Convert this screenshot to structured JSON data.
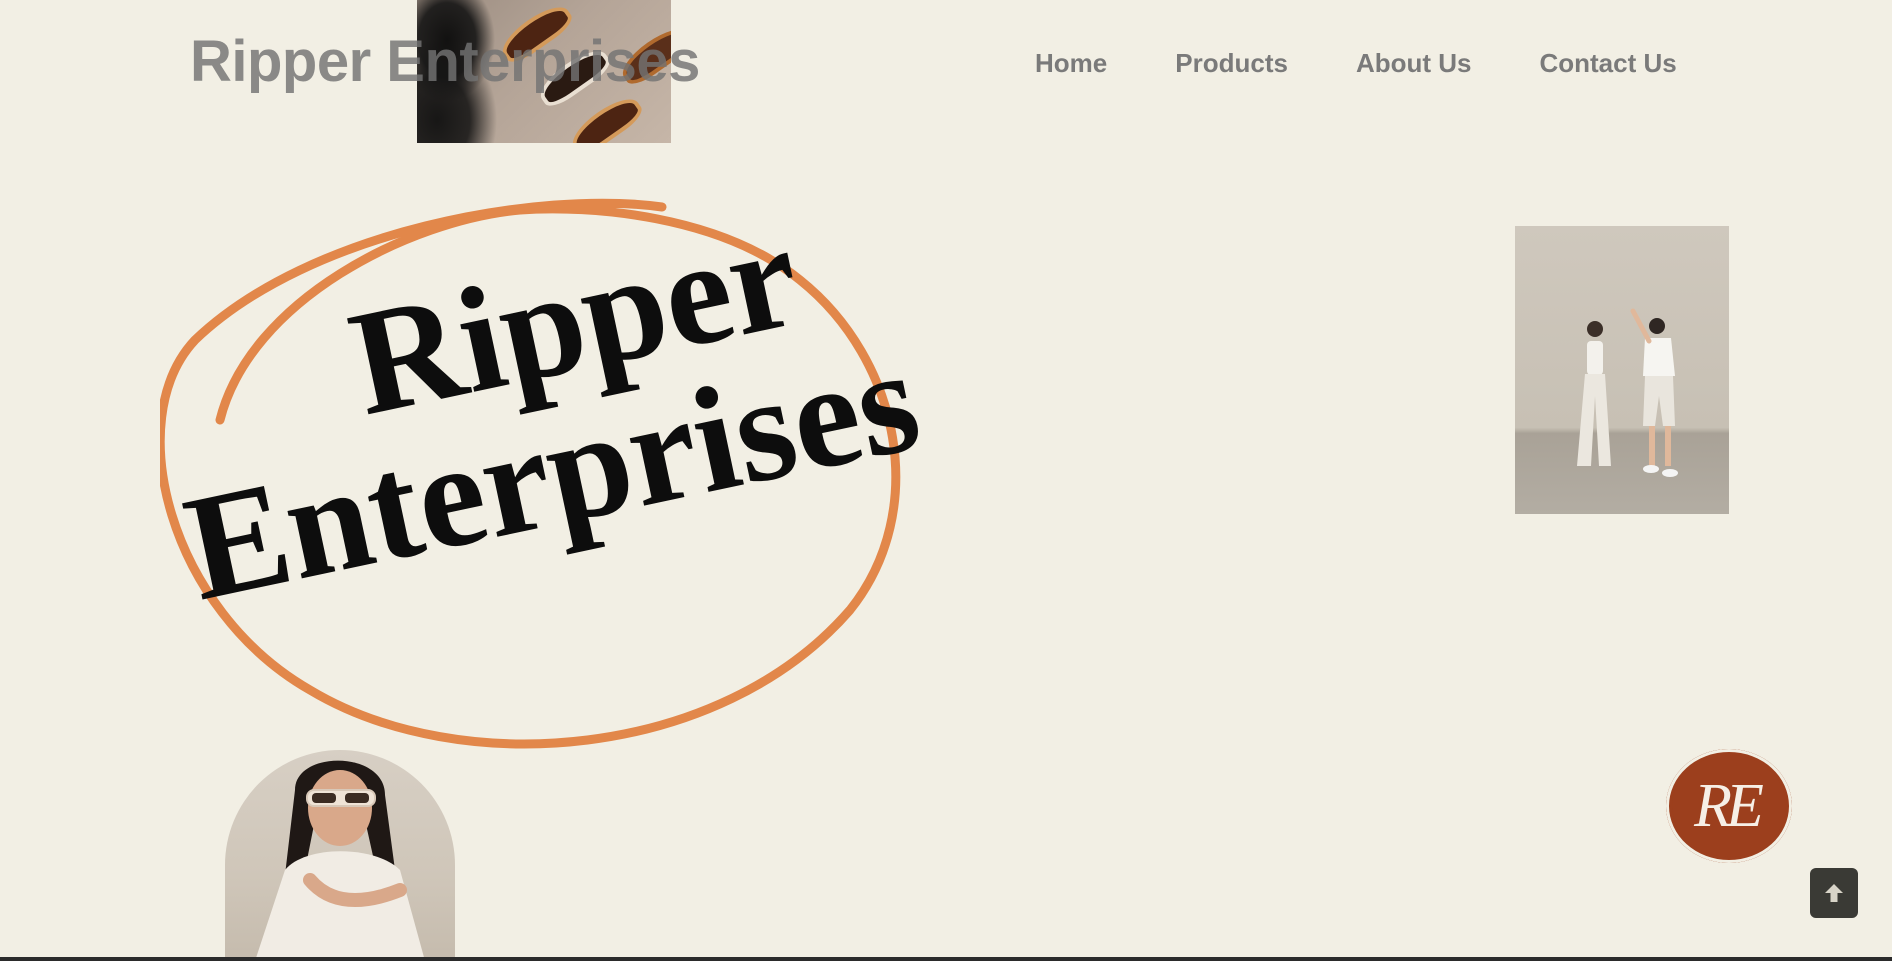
{
  "header": {
    "site_title": "Ripper Enterprises"
  },
  "nav": {
    "items": [
      {
        "label": "Home"
      },
      {
        "label": "Products"
      },
      {
        "label": "About Us"
      },
      {
        "label": "Contact Us"
      }
    ]
  },
  "hero": {
    "logo_word_1": "Ripper",
    "logo_word_2": "Enterprises",
    "accent_color": "#e2874a"
  },
  "badge": {
    "text": "RE",
    "color": "#9c3f1d"
  },
  "icons": {
    "scroll_top": "arrow-up-icon"
  },
  "colors": {
    "background": "#f2efe4",
    "nav_text": "#7a7a7a",
    "button": "#3a3a35"
  }
}
